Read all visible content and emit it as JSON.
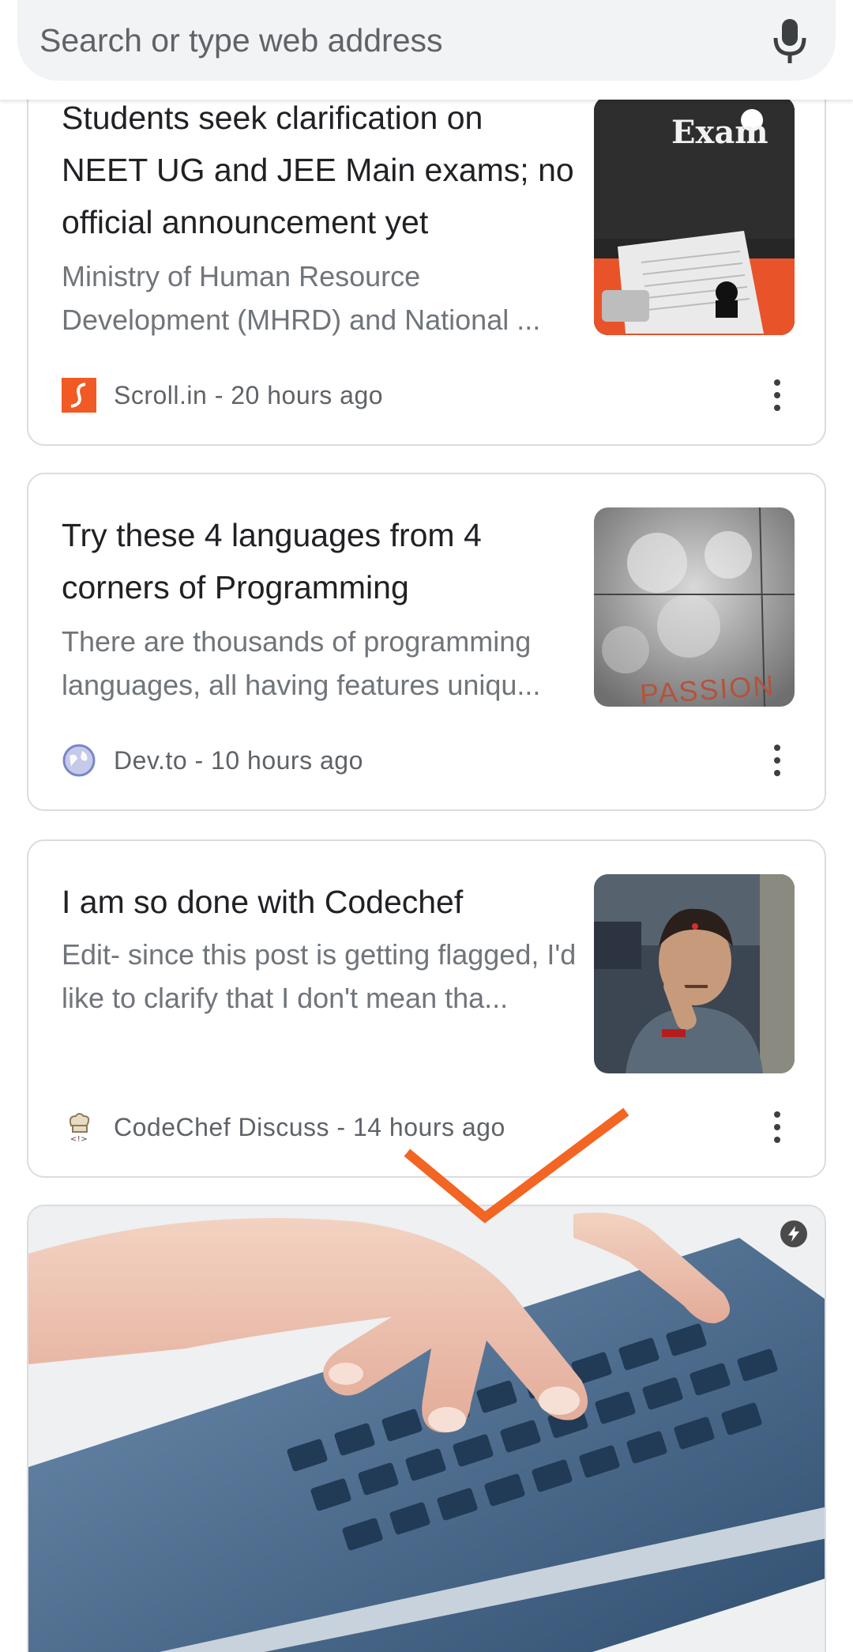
{
  "search": {
    "placeholder": "Search or type web address",
    "mic_icon": "microphone-icon"
  },
  "cards": [
    {
      "title": "Students seek clarification on NEET UG and JEE Main exams; no official announcement yet",
      "snippet": "Ministry of Human Resource Development (MHRD) and National ...",
      "source": "Scroll.in",
      "time": "20 hours ago",
      "source_line": "Scroll.in - 20 hours ago",
      "thumb_text": "Exam",
      "source_icon": "scroll-logo-icon",
      "brand_color": "#f15a24"
    },
    {
      "title": "Try these 4 languages from 4 corners of Programming",
      "snippet": "There are thousands of programming languages, all having features uniqu...",
      "source": "Dev.to",
      "time": "10 hours ago",
      "source_line": "Dev.to - 10 hours ago",
      "thumb_text": "PASSION",
      "source_icon": "globe-icon"
    },
    {
      "title": "I am so done with Codechef",
      "snippet": "Edit- since this post is getting flagged, I'd like to clarify that I don't mean tha...",
      "source": "CodeChef Discuss",
      "time": "14 hours ago",
      "source_line": "CodeChef Discuss - 14 hours ago",
      "source_icon": "chef-hat-icon"
    }
  ],
  "colors": {
    "accent_orange": "#f26522",
    "text_primary": "#202124",
    "text_secondary": "#70757a",
    "border": "#dadce0"
  }
}
